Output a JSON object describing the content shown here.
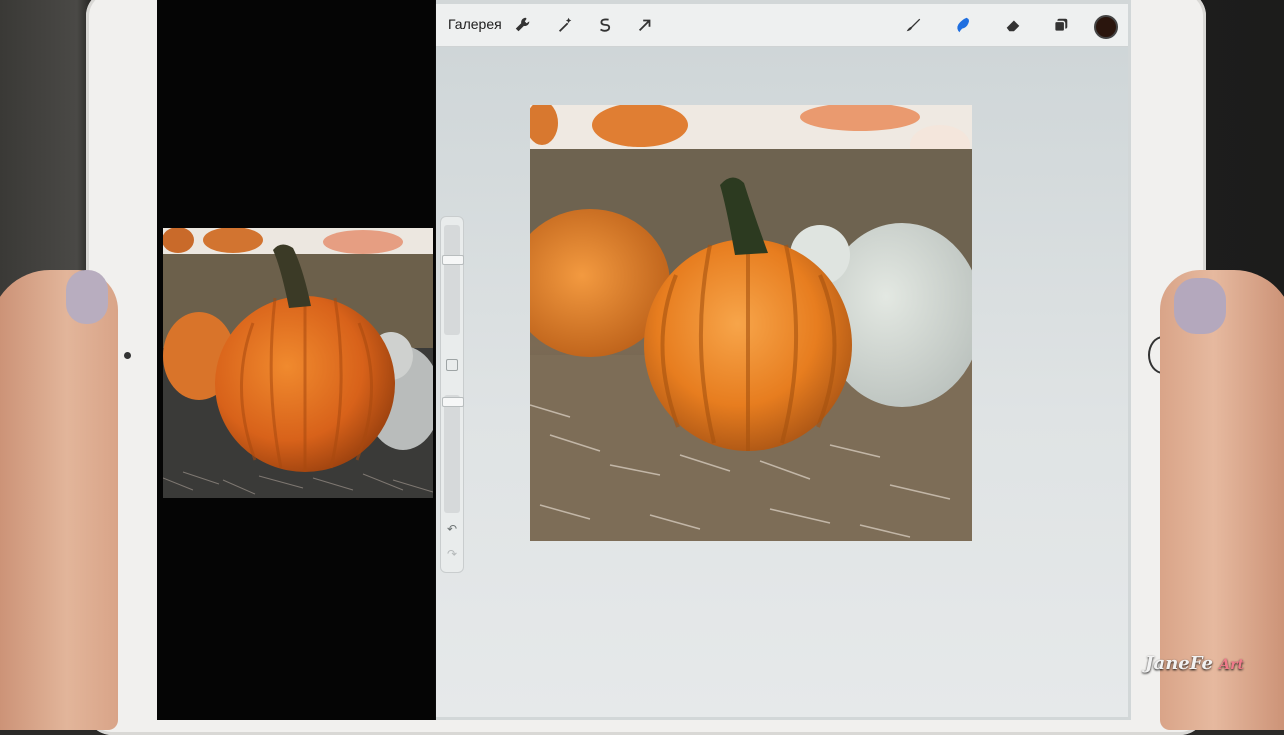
{
  "toolbar": {
    "gallery_label": "Галерея",
    "icons": {
      "actions": "wrench-icon",
      "adjustments": "magic-wand-icon",
      "selection": "selection-s-icon",
      "transform": "arrow-cursor-icon",
      "brush": "paintbrush-icon",
      "smudge": "smudge-icon",
      "eraser": "eraser-icon",
      "layers": "layers-icon"
    },
    "active_tool": "smudge",
    "accent": "#1f6fe0",
    "current_color": "#2a150d"
  },
  "sidebar": {
    "undo_icon": "undo-icon",
    "redo_icon": "redo-icon",
    "brush_size": 0.87,
    "opacity": 0.9
  },
  "watermark": {
    "name": "JaneFe",
    "suffix": "Art"
  }
}
